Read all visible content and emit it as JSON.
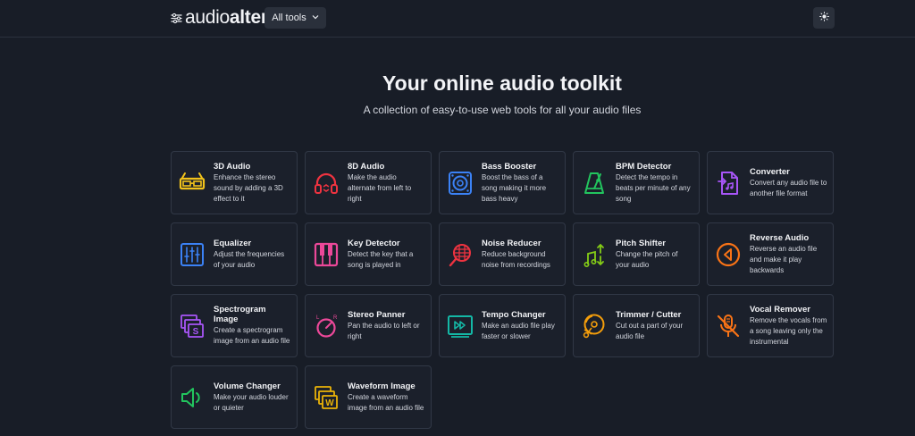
{
  "header": {
    "logo": {
      "part1": "audio",
      "part2": "alter"
    },
    "tools_button": "All tools"
  },
  "hero": {
    "title": "Your online audio toolkit",
    "subtitle": "A collection of easy-to-use web tools for all your audio files"
  },
  "tools": [
    {
      "title": "3D Audio",
      "desc": "Enhance the stereo sound by adding a 3D effect to it",
      "icon": "3d-glasses-icon",
      "color": "#f1c21b"
    },
    {
      "title": "8D Audio",
      "desc": "Make the audio alternate from left to right",
      "icon": "headphones-icon",
      "color": "#ef3340"
    },
    {
      "title": "Bass Booster",
      "desc": "Boost the bass of a song making it more bass heavy",
      "icon": "speaker-icon",
      "color": "#3b82f6"
    },
    {
      "title": "BPM Detector",
      "desc": "Detect the tempo in beats per minute of any song",
      "icon": "metronome-icon",
      "color": "#22c55e"
    },
    {
      "title": "Converter",
      "desc": "Convert any audio file to another file format",
      "icon": "file-convert-icon",
      "color": "#a855f7"
    },
    {
      "title": "Equalizer",
      "desc": "Adjust the frequencies of your audio",
      "icon": "equalizer-icon",
      "color": "#3b82f6"
    },
    {
      "title": "Key Detector",
      "desc": "Detect the key that a song is played in",
      "icon": "piano-keys-icon",
      "color": "#ec4899"
    },
    {
      "title": "Noise Reducer",
      "desc": "Reduce background noise from recordings",
      "icon": "microphone-icon",
      "color": "#ef3340"
    },
    {
      "title": "Pitch Shifter",
      "desc": "Change the pitch of your audio",
      "icon": "music-notes-icon",
      "color": "#84cc16"
    },
    {
      "title": "Reverse Audio",
      "desc": "Reverse an audio file and make it play backwards",
      "icon": "reverse-icon",
      "color": "#f97316"
    },
    {
      "title": "Spectrogram Image",
      "desc": "Create a spectrogram image from an audio file",
      "icon": "spectrogram-icon",
      "color": "#a855f7"
    },
    {
      "title": "Stereo Panner",
      "desc": "Pan the audio to left or right",
      "icon": "pan-knob-icon",
      "color": "#ec4899"
    },
    {
      "title": "Tempo Changer",
      "desc": "Make an audio file play faster or slower",
      "icon": "fast-forward-icon",
      "color": "#14b8a6"
    },
    {
      "title": "Trimmer / Cutter",
      "desc": "Cut out a part of your audio file",
      "icon": "scissors-disc-icon",
      "color": "#f59e0b"
    },
    {
      "title": "Vocal Remover",
      "desc": "Remove the vocals from a song leaving only the instrumental",
      "icon": "mic-off-icon",
      "color": "#f97316"
    },
    {
      "title": "Volume Changer",
      "desc": "Make your audio louder or quieter",
      "icon": "volume-icon",
      "color": "#22c55e"
    },
    {
      "title": "Waveform Image",
      "desc": "Create a waveform image from an audio file",
      "icon": "waveform-image-icon",
      "color": "#eab308"
    }
  ]
}
